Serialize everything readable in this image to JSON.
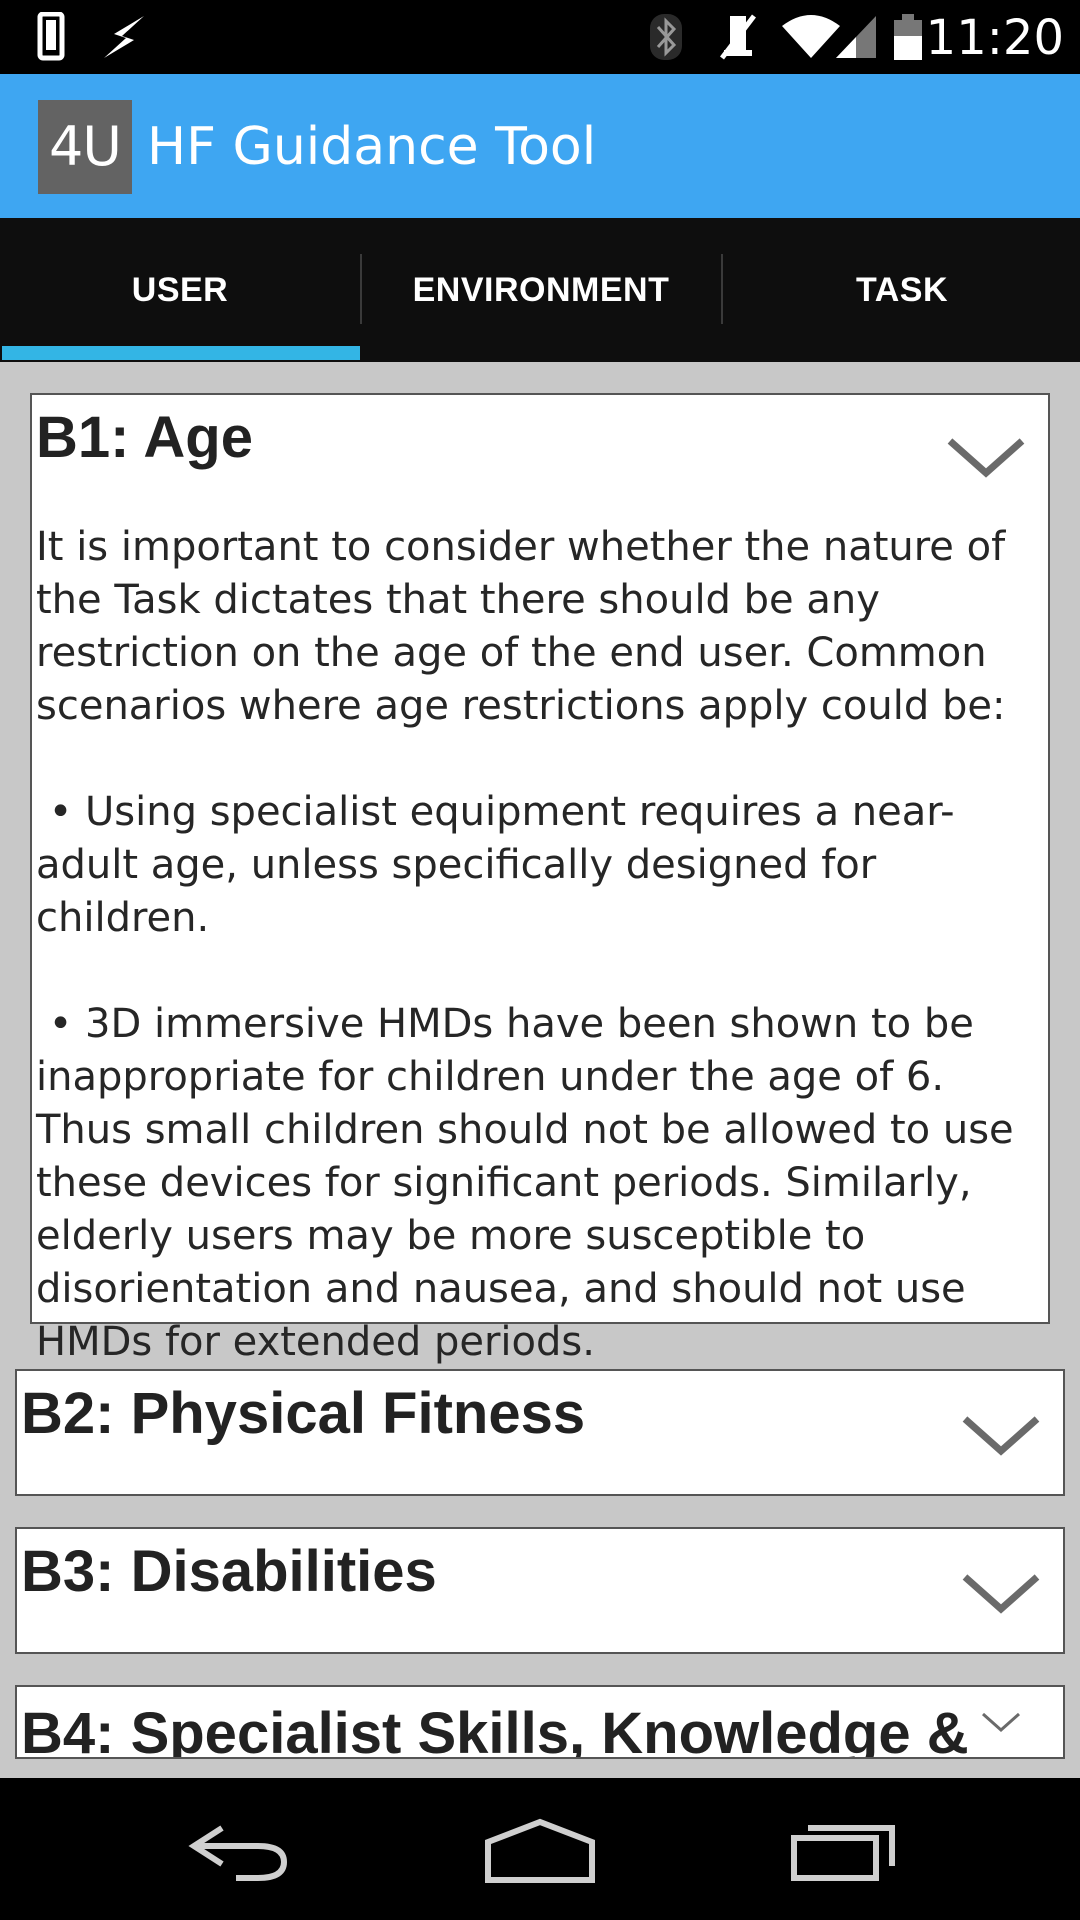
{
  "status_bar": {
    "time": "11:20",
    "icons": [
      "phone-icon",
      "charging-icon",
      "bluetooth-icon",
      "mute-icon",
      "wifi-icon",
      "signal-icon",
      "battery-icon"
    ]
  },
  "action_bar": {
    "logo_text": "4U",
    "title": "HF Guidance Tool",
    "color": "#3ea6f2"
  },
  "tabs": [
    {
      "label": "USER",
      "selected": true
    },
    {
      "label": "ENVIRONMENT",
      "selected": false
    },
    {
      "label": "TASK",
      "selected": false
    }
  ],
  "sections": [
    {
      "title": "B1: Age",
      "expanded": true,
      "body": "It is important to consider whether the nature of the Task dictates that there should be any restriction on the age of the end user. Common scenarios where age restrictions apply could be:\n\n • Using specialist equipment requires a near-adult age, unless specifically designed for children.\n\n • 3D immersive HMDs have been shown to be inappropriate for children under the age of 6. Thus small children should not be allowed to use these devices for significant periods. Similarly, elderly users may be more susceptible to disorientation and nausea, and should not use HMDs for extended periods."
    },
    {
      "title": "B2: Physical Fitness",
      "expanded": false
    },
    {
      "title": "B3: Disabilities",
      "expanded": false
    },
    {
      "title": "B4: Specialist Skills, Knowledge &",
      "expanded": false
    }
  ],
  "nav_bar": {
    "buttons": [
      "back-icon",
      "home-icon",
      "recent-apps-icon"
    ]
  }
}
